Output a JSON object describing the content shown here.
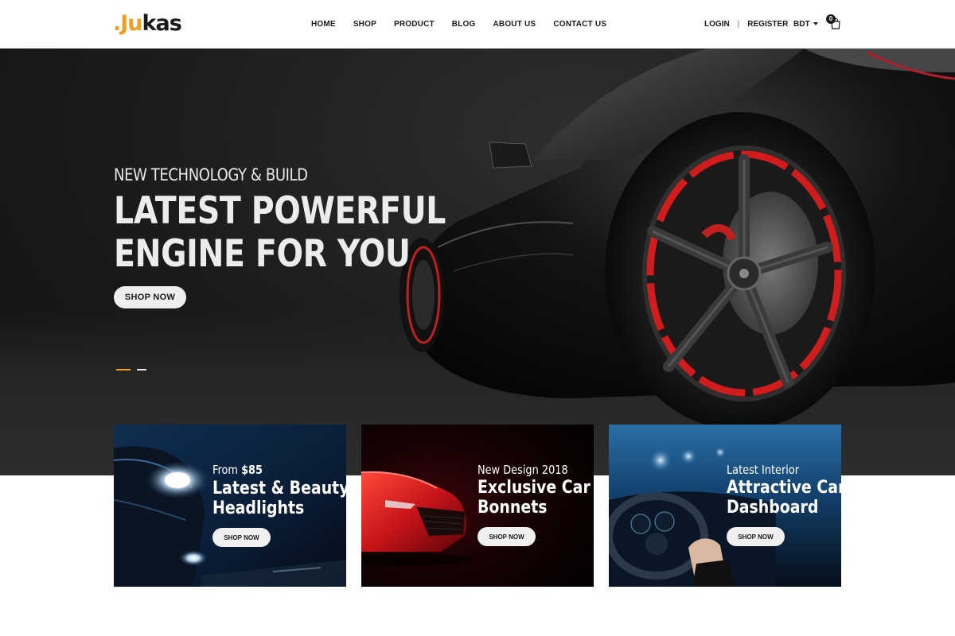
{
  "brand": {
    "logo_dot": ".",
    "logo_accent": "Ju",
    "logo_rest": "kas"
  },
  "nav": [
    {
      "label": "HOME"
    },
    {
      "label": "SHOP"
    },
    {
      "label": "PRODUCT"
    },
    {
      "label": "BLOG"
    },
    {
      "label": "ABOUT US"
    },
    {
      "label": "CONTACT US"
    }
  ],
  "account": {
    "login": "LOGIN",
    "separator": "|",
    "register": "REGISTER"
  },
  "currency": {
    "selected": "BDT"
  },
  "cart": {
    "count": "0",
    "icon": "shopping-bag-icon"
  },
  "hero": {
    "subtitle": "NEW TECHNOLOGY & BUILD",
    "title_line1": "LATEST POWERFUL",
    "title_line2": "ENGINE FOR YOU",
    "button": "SHOP NOW",
    "slides": 2,
    "active_slide": 1
  },
  "promos": [
    {
      "kicker_prefix": "From ",
      "kicker_strong": "$85",
      "title_line1": "Latest & Beauty",
      "title_line2": "Headlights",
      "button": "SHOP NOW"
    },
    {
      "kicker_prefix": "New Design 2018",
      "kicker_strong": "",
      "title_line1": "Exclusive Car",
      "title_line2": "Bonnets",
      "button": "SHOP NOW"
    },
    {
      "kicker_prefix": "Latest Interior",
      "kicker_strong": "",
      "title_line1": "Attractive Car",
      "title_line2": "Dashboard",
      "button": "SHOP NOW"
    }
  ],
  "colors": {
    "accent": "#f0a020",
    "dark": "#1a1a1a",
    "hero_bg": "#1e1e1e",
    "card_red": "#d81c1c",
    "card_blue": "#1a4a7a"
  }
}
